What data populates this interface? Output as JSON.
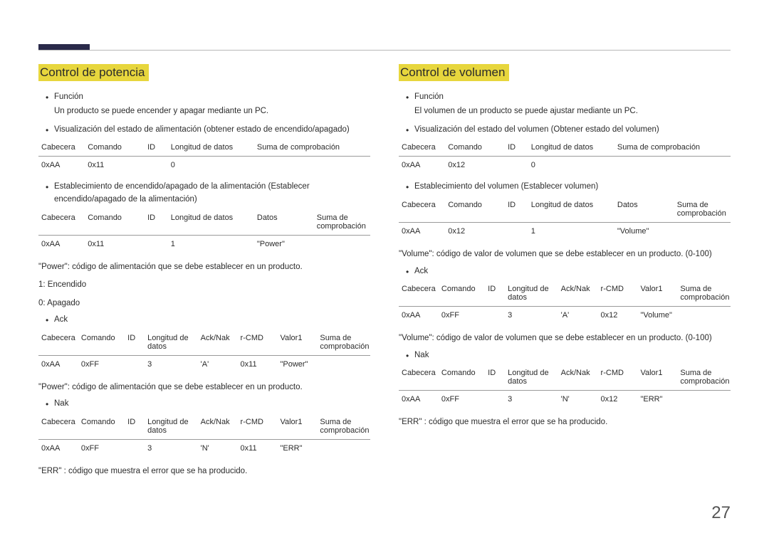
{
  "page_number": "27",
  "left": {
    "title": "Control de potencia",
    "funcion_label": "Función",
    "funcion_desc": "Un producto se puede encender y apagar mediante un PC.",
    "viz_label": "Visualización del estado de alimentación (obtener estado de encendido/apagado)",
    "t1": {
      "h": [
        "Cabecera",
        "Comando",
        "ID",
        "Longitud de datos",
        "Suma de comprobación"
      ],
      "r": [
        "0xAA",
        "0x11",
        "",
        "0",
        ""
      ]
    },
    "set_label": "Establecimiento de encendido/apagado de la alimentación (Establecer encendido/apagado de la alimentación)",
    "t2": {
      "h": [
        "Cabecera",
        "Comando",
        "ID",
        "Longitud de datos",
        "Datos",
        "Suma de comprobación"
      ],
      "r": [
        "0xAA",
        "0x11",
        "",
        "1",
        "\"Power\"",
        ""
      ]
    },
    "code_desc": "\"Power\": código de alimentación que se debe establecer en un producto.",
    "val1": "1: Encendido",
    "val0": "0: Apagado",
    "ack_label": "Ack",
    "t3": {
      "h": [
        "Cabecera",
        "Comando",
        "ID",
        "Longitud de datos",
        "Ack/Nak",
        "r-CMD",
        "Valor1",
        "Suma de comprobación"
      ],
      "r": [
        "0xAA",
        "0xFF",
        "",
        "3",
        "'A'",
        "0x11",
        "\"Power\"",
        ""
      ]
    },
    "code_desc2": "\"Power\": código de alimentación que se debe establecer en un producto.",
    "nak_label": "Nak",
    "t4": {
      "h": [
        "Cabecera",
        "Comando",
        "ID",
        "Longitud de datos",
        "Ack/Nak",
        "r-CMD",
        "Valor1",
        "Suma de comprobación"
      ],
      "r": [
        "0xAA",
        "0xFF",
        "",
        "3",
        "'N'",
        "0x11",
        "\"ERR\"",
        ""
      ]
    },
    "err_desc": "\"ERR\" : código que muestra el error que se ha producido."
  },
  "right": {
    "title": "Control de volumen",
    "funcion_label": "Función",
    "funcion_desc": "El volumen de un producto se puede ajustar mediante un PC.",
    "viz_label": "Visualización del estado del volumen (Obtener estado del volumen)",
    "t1": {
      "h": [
        "Cabecera",
        "Comando",
        "ID",
        "Longitud de datos",
        "Suma de comprobación"
      ],
      "r": [
        "0xAA",
        "0x12",
        "",
        "0",
        ""
      ]
    },
    "set_label": "Establecimiento del volumen (Establecer volumen)",
    "t2": {
      "h": [
        "Cabecera",
        "Comando",
        "ID",
        "Longitud de datos",
        "Datos",
        "Suma de comprobación"
      ],
      "r": [
        "0xAA",
        "0x12",
        "",
        "1",
        "\"Volume\"",
        ""
      ]
    },
    "code_desc": "\"Volume\": código de valor de volumen que se debe establecer en un producto. (0-100)",
    "ack_label": "Ack",
    "t3": {
      "h": [
        "Cabecera",
        "Comando",
        "ID",
        "Longitud de datos",
        "Ack/Nak",
        "r-CMD",
        "Valor1",
        "Suma de comprobación"
      ],
      "r": [
        "0xAA",
        "0xFF",
        "",
        "3",
        "'A'",
        "0x12",
        "\"Volume\"",
        ""
      ]
    },
    "code_desc2": "\"Volume\": código de valor de volumen que se debe establecer en un producto. (0-100)",
    "nak_label": "Nak",
    "t4": {
      "h": [
        "Cabecera",
        "Comando",
        "ID",
        "Longitud de datos",
        "Ack/Nak",
        "r-CMD",
        "Valor1",
        "Suma de comprobación"
      ],
      "r": [
        "0xAA",
        "0xFF",
        "",
        "3",
        "'N'",
        "0x12",
        "\"ERR\"",
        ""
      ]
    },
    "err_desc": "\"ERR\" : código que muestra el error que se ha producido."
  }
}
